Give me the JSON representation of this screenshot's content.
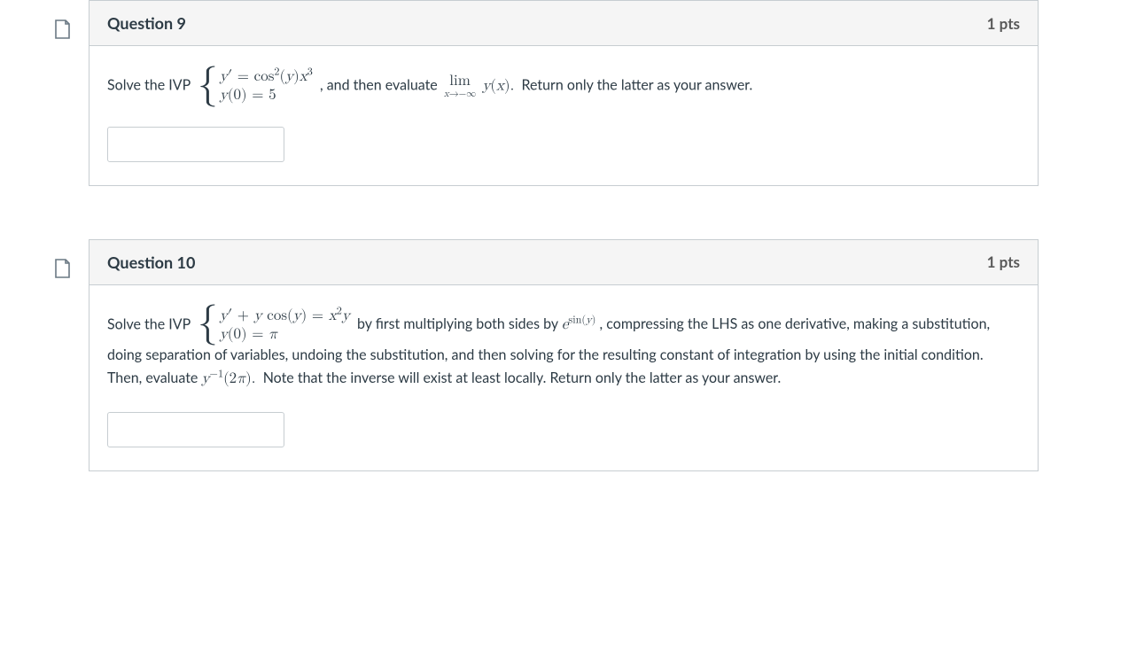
{
  "questions": [
    {
      "title": "Question 9",
      "points": "1 pts",
      "prompt_prefix": "Solve the IVP",
      "ivp_eq1": "y′ = cos²(y)x³",
      "ivp_eq2": "y(0) = 5",
      "mid_text": ", and then evaluate",
      "lim_top": "lim",
      "lim_sub": "x→−∞",
      "lim_expr": "y(x).",
      "suffix": "Return only the latter as your answer.",
      "answer_value": ""
    },
    {
      "title": "Question 10",
      "points": "1 pts",
      "prompt_prefix": "Solve the IVP",
      "ivp_eq1": "y′ + y cos(y) = x²y",
      "ivp_eq2": "y(0) = π",
      "mid_text_1": "by first multiplying both sides by ",
      "mid_math_1": "e",
      "mid_math_1_sup": "sin(y)",
      "mid_text_2": " , compressing the LHS as one derivative, making a substitution, doing separation of variables, undoing the substitution, and then solving for the resulting constant of integration by using the initial condition.  Then, evaluate ",
      "mid_math_2": "y",
      "mid_math_2_sup": "−1",
      "mid_math_2_arg": "(2π).",
      "suffix": "Note that the inverse will exist at least locally.  Return only the latter as your answer.",
      "answer_value": ""
    }
  ]
}
